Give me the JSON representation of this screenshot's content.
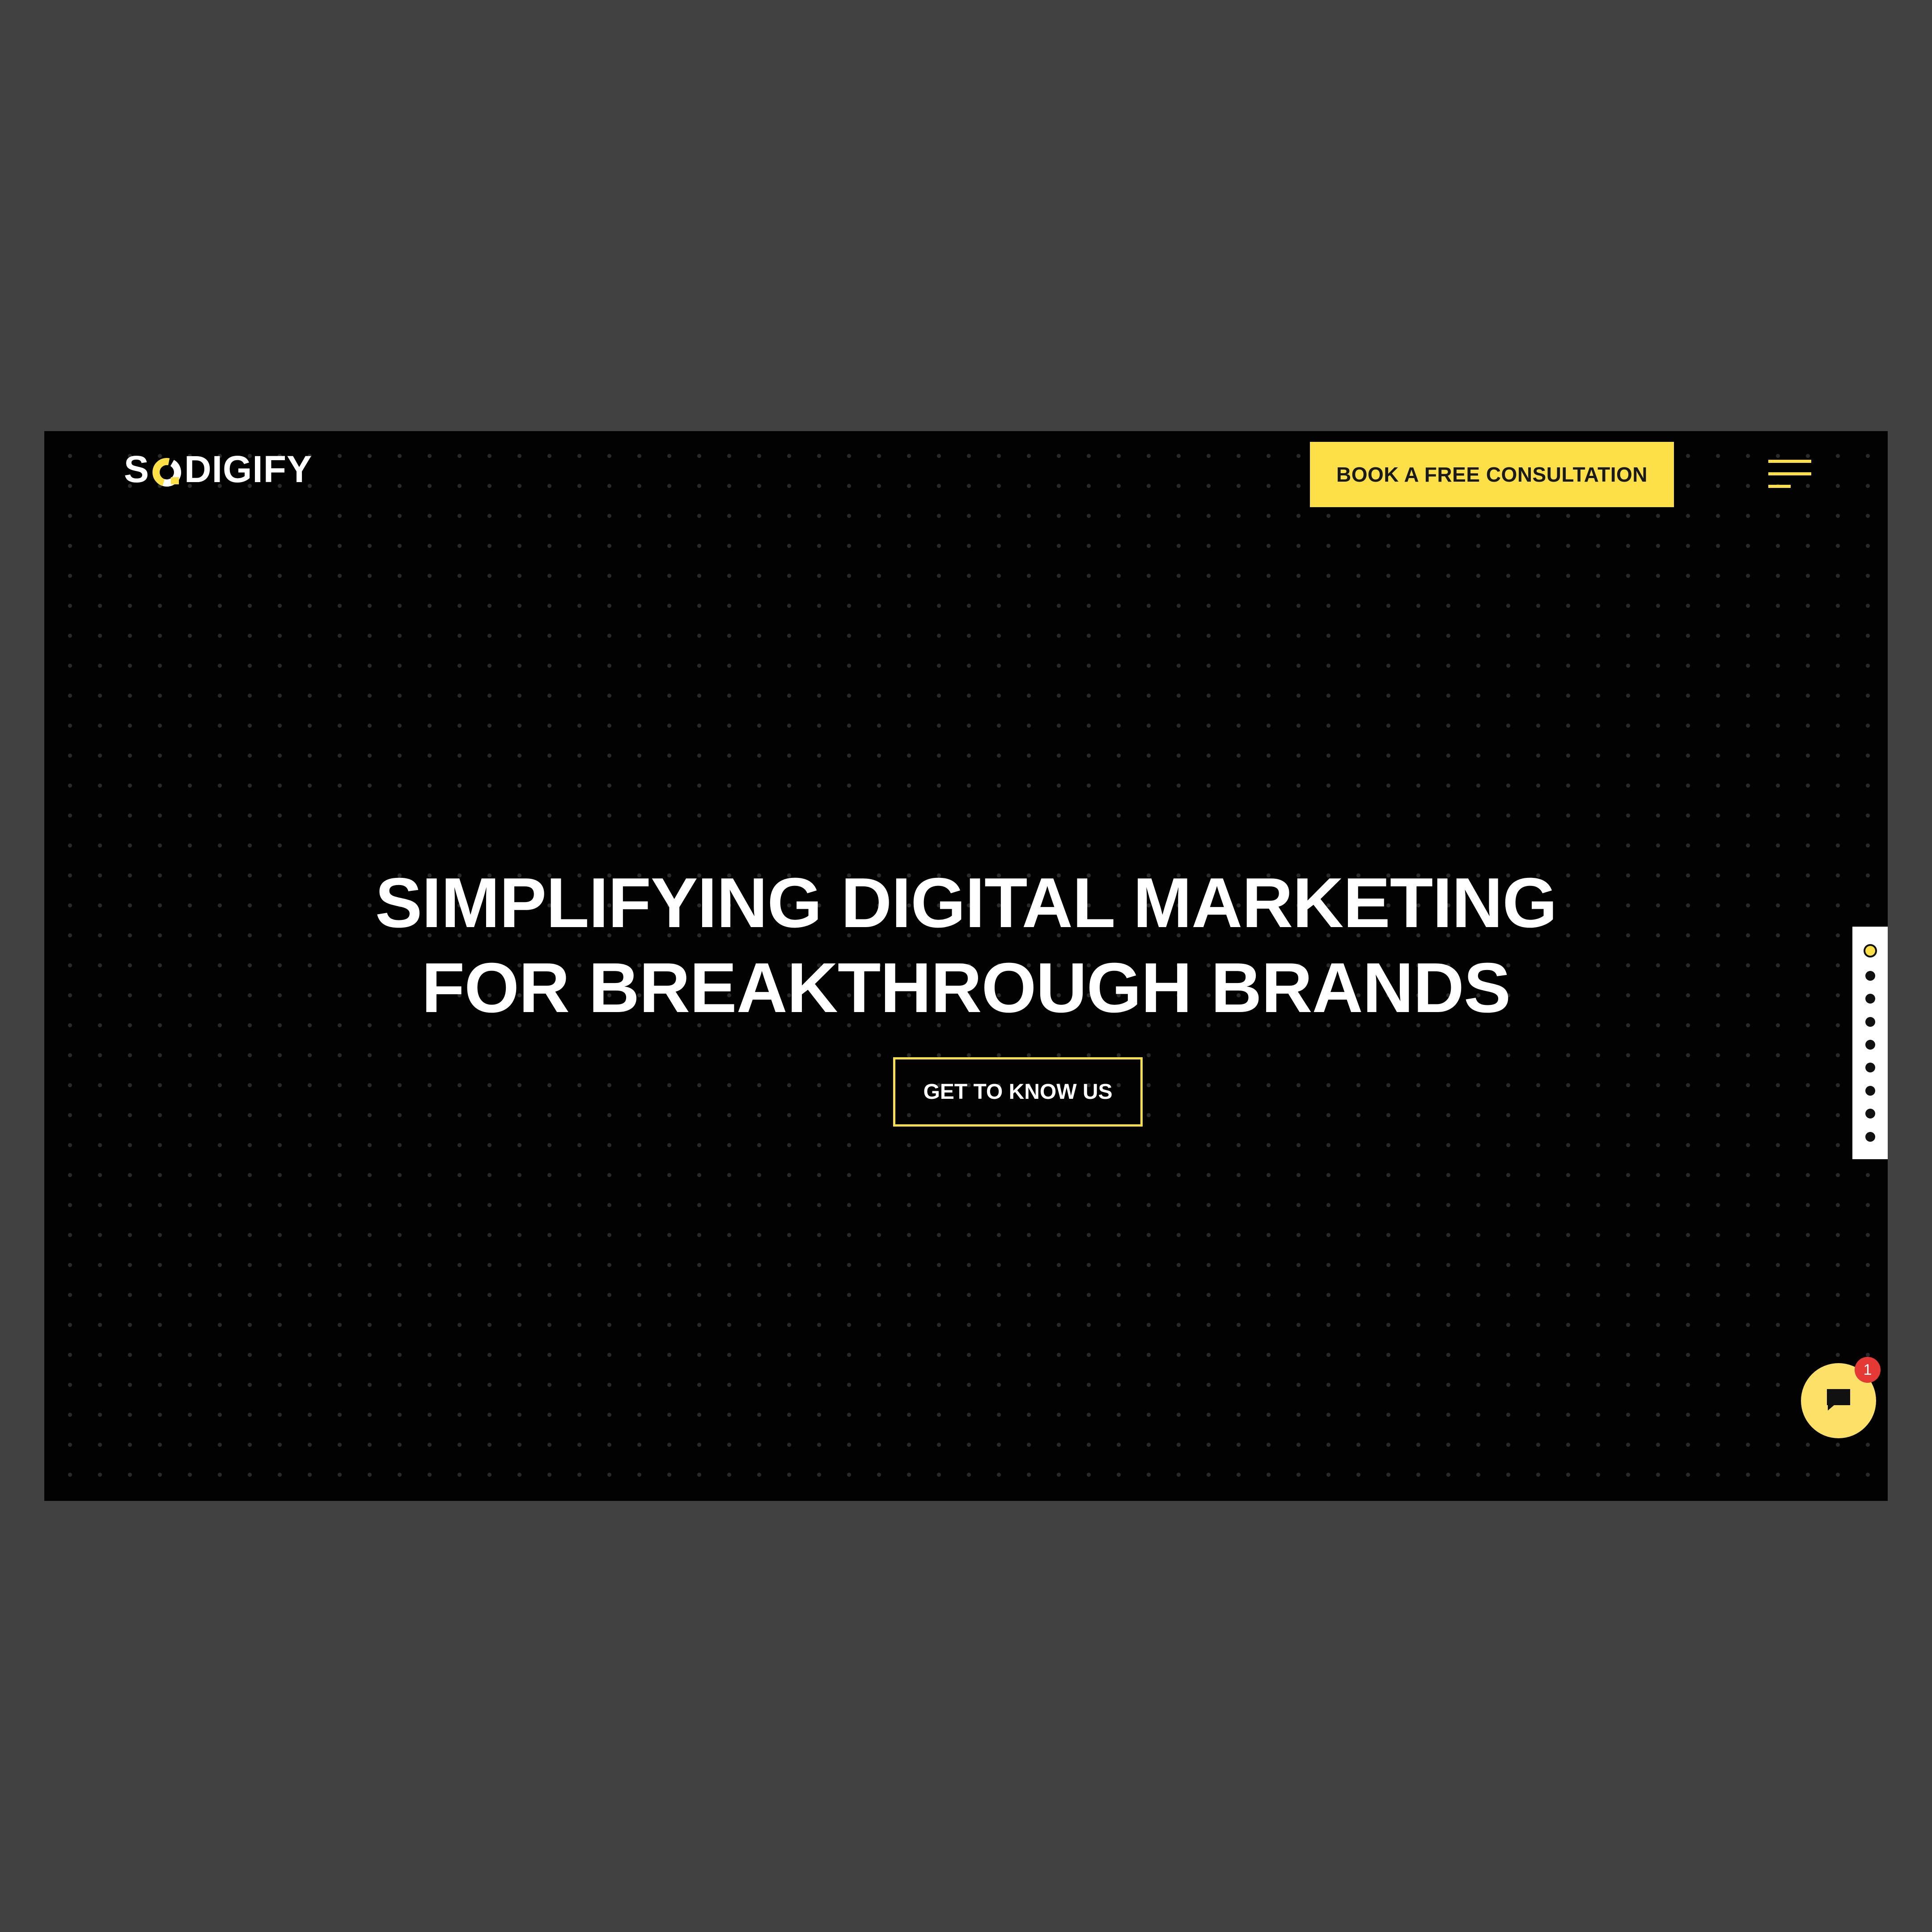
{
  "brand": {
    "logo_text": "DIGIFY",
    "logo_letter": "S",
    "accent_color": "#fde047"
  },
  "header": {
    "book_label": "BOOK A FREE CONSULTATION",
    "menu_icon": "hamburger-menu-icon"
  },
  "hero": {
    "title_line_1": "SIMPLIFYING DIGITAL MARKETING",
    "title_line_2": "FOR BREAKTHROUGH BRANDS",
    "cta_label": "GET TO KNOW US"
  },
  "dot_nav": {
    "count": 9,
    "active_index": 0
  },
  "chat": {
    "icon": "chat-bubble-icon",
    "badge_count": "1"
  }
}
